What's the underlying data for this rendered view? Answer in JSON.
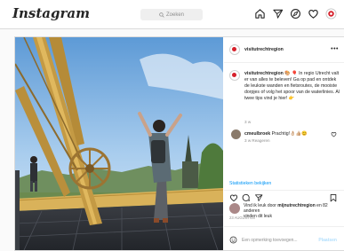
{
  "header": {
    "logo": "Instagram",
    "search_placeholder": "Zoeken",
    "icons": [
      "home-icon",
      "direct-icon",
      "explore-icon",
      "activity-icon",
      "profile-avatar"
    ]
  },
  "post": {
    "username": "visitutrechtregion",
    "more": "•••",
    "caption_user": "visitutrechtregion",
    "caption_text": "🎨 🎈 In regio Utrecht valt er van alles te beleven! Ga op pad en ontdek de leukste wanden en fietsroutes, de mooiste dorpjes of volg het spoor van de waterlinies. Al twee tips vind je hier! 👉",
    "caption_time": "3 w",
    "comment_user": "cmeulbroek",
    "comment_text": "Prachtig!👌🏼👍🏼😊",
    "comment_meta": "3 w   Reageren",
    "stats_link": "Statistieken bekijken",
    "likes_text": "Vind ik leuk door",
    "likes_user": "mijnutrechtregion",
    "likes_count": "en 82 anderen",
    "likes_text2": "vinden dit leuk",
    "date": "23 AUGUSTUS",
    "comment_placeholder": "Een opmerking toevoegen...",
    "post_button": "Plaatsen"
  },
  "colors": {
    "accent": "#0095f6",
    "brand_red": "#d6202b"
  }
}
